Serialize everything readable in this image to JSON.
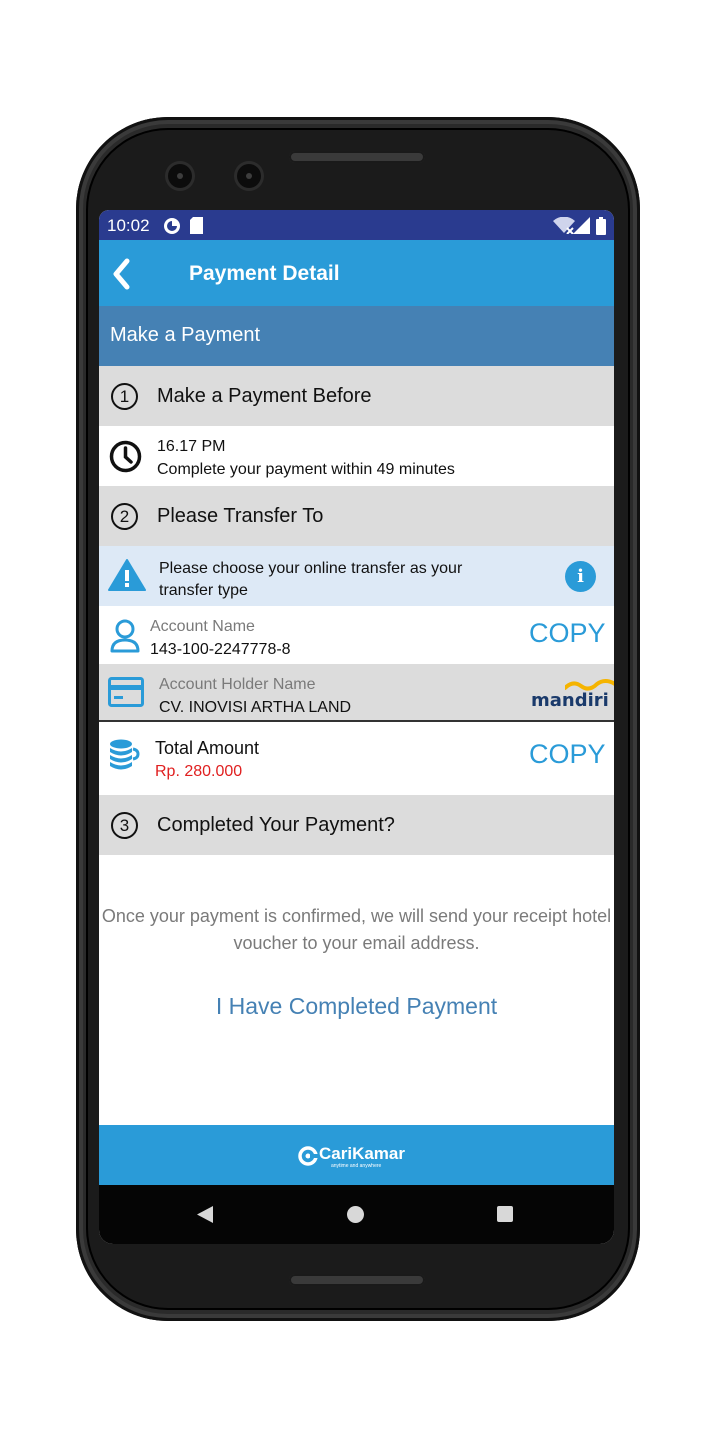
{
  "status_bar": {
    "time": "10:02"
  },
  "app_bar": {
    "title": "Payment Detail"
  },
  "section": {
    "title": "Make a Payment"
  },
  "step1": {
    "number": "1",
    "label": "Make a Payment Before",
    "deadline_time": "16.17 PM",
    "deadline_note": "Complete your payment within 49 minutes"
  },
  "step2": {
    "number": "2",
    "label": "Please Transfer To",
    "warning": "Please choose your online transfer as your transfer type",
    "account_name_label": "Account Name",
    "account_name_value": "143-100-2247778-8",
    "copy_label": "COPY",
    "holder_label": "Account Holder Name",
    "holder_value": "CV. INOVISI ARTHA LAND",
    "bank_logo_text": "mandiri",
    "total_label": "Total Amount",
    "total_value": "Rp. 280.000"
  },
  "step3": {
    "number": "3",
    "label": "Completed Your Payment?",
    "info": "Once your payment is confirmed, we will send your receipt hotel voucher to your email address.",
    "button": "I Have Completed Payment"
  },
  "footer": {
    "brand": "CariKamar",
    "tagline": "anytime and anywhere"
  },
  "colors": {
    "status_bar": "#2a3b8f",
    "app_bar": "#2a9bd8",
    "section_header": "#4581b4",
    "step_row": "#dcdcdc",
    "warning_row": "#dde9f6",
    "amount": "#e02020",
    "link": "#4581b4"
  }
}
